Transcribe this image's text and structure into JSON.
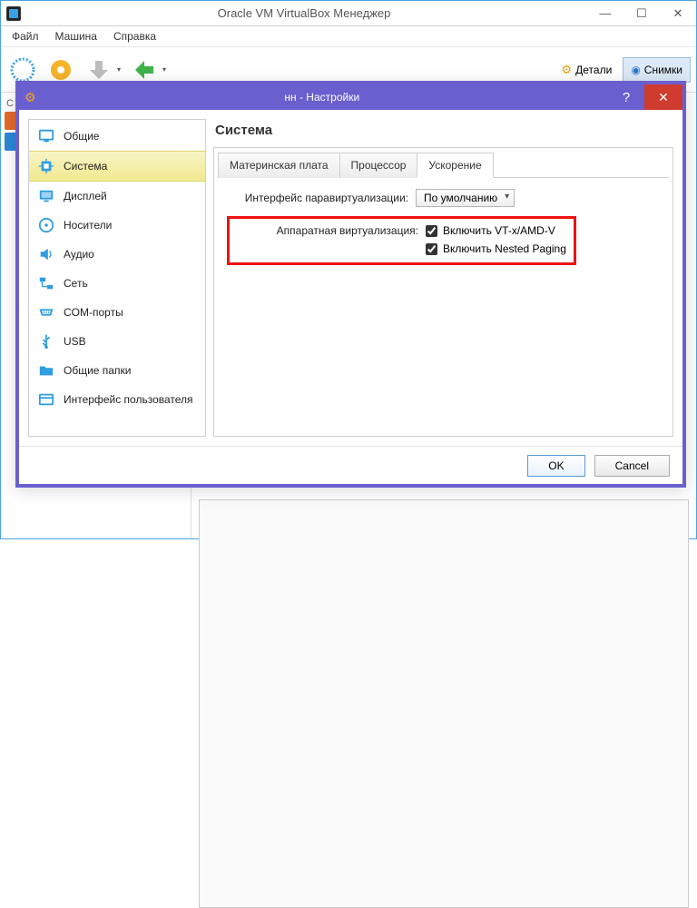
{
  "main_window": {
    "title": "Oracle VM VirtualBox Менеджер",
    "menu": {
      "file": "Файл",
      "machine": "Машина",
      "help": "Справка"
    },
    "toolbar_right": {
      "details": "Детали",
      "snapshots": "Снимки"
    }
  },
  "dialog": {
    "title": "нн - Настройки",
    "sidebar": {
      "items": [
        {
          "id": "general",
          "label": "Общие"
        },
        {
          "id": "system",
          "label": "Система"
        },
        {
          "id": "display",
          "label": "Дисплей"
        },
        {
          "id": "storage",
          "label": "Носители"
        },
        {
          "id": "audio",
          "label": "Аудио"
        },
        {
          "id": "network",
          "label": "Сеть"
        },
        {
          "id": "serial",
          "label": "COM-порты"
        },
        {
          "id": "usb",
          "label": "USB"
        },
        {
          "id": "shared",
          "label": "Общие папки"
        },
        {
          "id": "ui",
          "label": "Интерфейс пользователя"
        }
      ],
      "selected": "system"
    },
    "content": {
      "heading": "Система",
      "tabs": {
        "motherboard": "Материнская плата",
        "processor": "Процессор",
        "acceleration": "Ускорение",
        "active": "acceleration"
      },
      "accel": {
        "paravirt_label": "Интерфейс паравиртуализации:",
        "paravirt_value": "По умолчанию",
        "hwvirt_label": "Аппаратная виртуализация:",
        "enable_vtx": "Включить VT-x/AMD-V",
        "enable_nested": "Включить  Nested Paging",
        "vtx_checked": true,
        "nested_checked": true
      }
    },
    "buttons": {
      "ok": "OK",
      "cancel": "Cancel"
    }
  }
}
